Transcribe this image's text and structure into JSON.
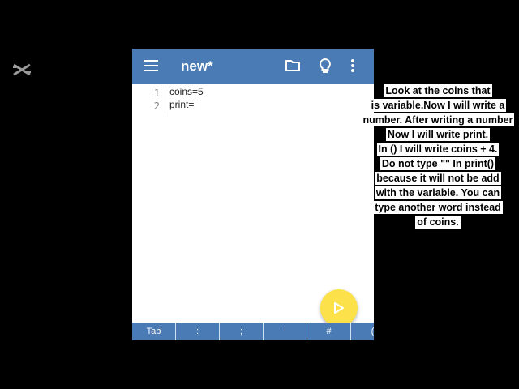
{
  "app": {
    "title": "new*",
    "code_lines": [
      {
        "number": "1",
        "text": "coins=5"
      },
      {
        "number": "2",
        "text": "print="
      }
    ],
    "keybar": [
      "Tab",
      ":",
      ";",
      "'",
      "#",
      "("
    ],
    "accent_color": "#4a7bb5",
    "fab_color": "#fde14a",
    "icons": [
      "menu-icon",
      "folder-icon",
      "lightbulb-icon",
      "more-vertical-icon",
      "play-icon"
    ]
  },
  "overlay": {
    "watermark_icon": "capcut-logo-icon",
    "caption_lines": [
      "Look at the coins that",
      "is variable.Now I will write a",
      "number. After writing a number",
      "Now I will write print.",
      "In () I will write coins + 4.",
      "Do not type \"\" In print()",
      "because it will not be add",
      "with the variable. You can",
      "type another word instead",
      "of coins."
    ]
  }
}
